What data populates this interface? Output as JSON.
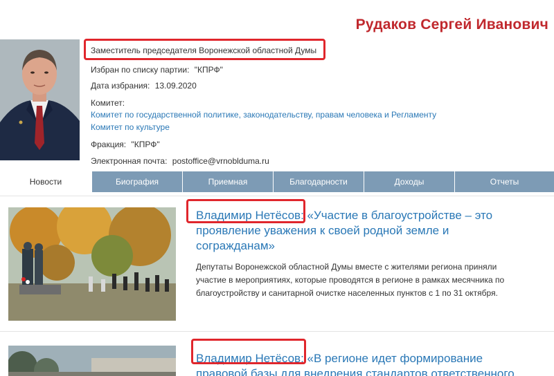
{
  "deputy": {
    "name": "Рудаков Сергей Иванович",
    "position": "Заместитель председателя Воронежской областной Думы",
    "party_label": "Избран по списку партии:",
    "party_value": "\"КПРФ\"",
    "election_label": "Дата избрания:",
    "election_value": "13.09.2020",
    "committee_label": "Комитет:",
    "committees": [
      "Комитет по государственной политике, законодательству, правам человека и Регламенту",
      "Комитет по культуре"
    ],
    "faction_label": "Фракция:",
    "faction_value": "\"КПРФ\"",
    "email_label": "Электронная почта:",
    "email_value": "postoffice@vrnoblduma.ru"
  },
  "tabs": [
    {
      "label": "Новости",
      "active": true
    },
    {
      "label": "Биография",
      "active": false
    },
    {
      "label": "Приемная",
      "active": false
    },
    {
      "label": "Благодарности",
      "active": false
    },
    {
      "label": "Доходы",
      "active": false
    },
    {
      "label": "Отчеты",
      "active": false
    }
  ],
  "news": [
    {
      "title": "Владимир Нетёсов: «Участие в благоустройстве – это проявление уважения к своей родной земле и согражданам»",
      "text": "Депутаты Воронежской областной Думы вместе с жителями региона приняли участие в мероприятиях, которые проводятся в регионе в рамках месячника по благоустройству и санитарной очистке населенных пунктов с 1 по 31 октября."
    },
    {
      "title": "Владимир Нетёсов: «В регионе идет формирование правовой базы для внедрения стандартов ответственного",
      "text": ""
    }
  ],
  "colors": {
    "name_red": "#c0282d",
    "link_blue": "#2a78b6",
    "tab_bg": "#7d9bb5",
    "highlight": "#e0262c"
  }
}
